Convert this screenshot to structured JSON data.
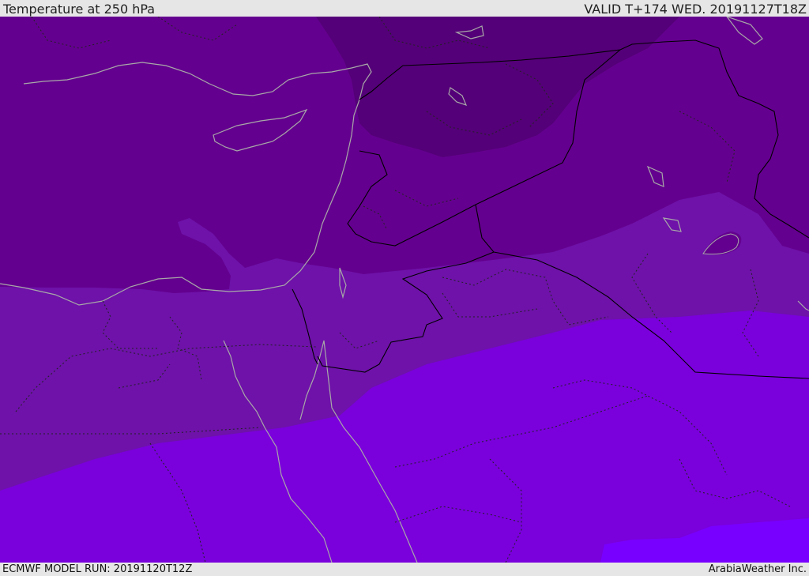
{
  "header": {
    "title": "Temperature at 250 hPa",
    "valid": "VALID T+174 WED. 20191127T18Z"
  },
  "footer": {
    "model_run": "ECMWF MODEL RUN: 20191120T12Z",
    "credit": "ArabiaWeather Inc."
  },
  "map": {
    "fill_colors": {
      "darkest": "#540078",
      "dark": "#64008f",
      "mid": "#6e12a9",
      "light": "#7a00dc",
      "lightest": "#7800ff"
    },
    "line_colors": {
      "coastline": "#a8a8a8",
      "border": "#000000",
      "admin": "#222222"
    }
  }
}
